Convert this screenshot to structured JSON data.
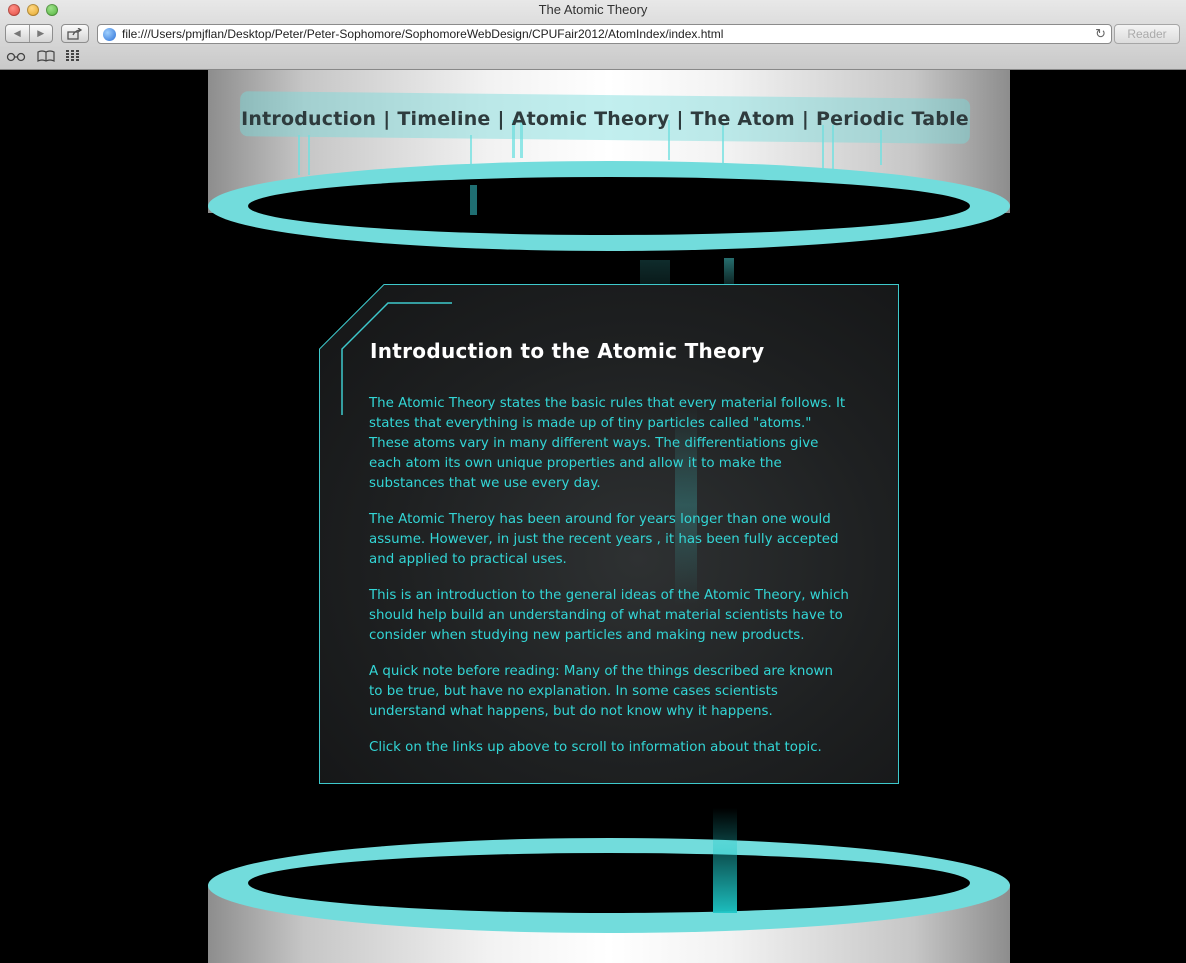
{
  "window": {
    "title": "The Atomic Theory"
  },
  "toolbar": {
    "url": "file:///Users/pmjflan/Desktop/Peter/Peter-Sophomore/SophomoreWebDesign/CPUFair2012/AtomIndex/index.html",
    "reader_label": "Reader"
  },
  "bookmarks": [
    {
      "icon": "reading-list-icon"
    },
    {
      "icon": "bookmarks-book-icon"
    },
    {
      "icon": "top-sites-grid-icon"
    }
  ],
  "nav": {
    "links": [
      "Introduction",
      "Timeline",
      "Atomic Theory",
      "The Atom",
      "Periodic Table"
    ],
    "separator": "|"
  },
  "content": {
    "heading": "Introduction to the Atomic Theory",
    "paragraphs": [
      "The Atomic Theory states the basic rules that every material follows. It states that everything is made up of tiny particles called \"atoms.\" These atoms vary in many different ways. The differentiations give each atom its own unique properties and allow it to make the substances that we use every day.",
      "The Atomic Theroy has been around for years longer than one would assume. However, in just the recent years , it has been fully accepted and applied to practical uses.",
      "This is an introduction to the general ideas of the Atomic Theory, which should help build an understanding of what material scientists have to consider when studying new particles and making new products.",
      "A quick note before reading: Many of the things described are known to be true, but have no explanation. In some cases scientists understand what happens, but do not know why it happens.",
      "Click on the links up above to scroll to information about that topic."
    ]
  },
  "colors": {
    "accent": "#72dcdc",
    "text": "#33d6d6",
    "heading": "#ffffff",
    "background": "#000000"
  }
}
